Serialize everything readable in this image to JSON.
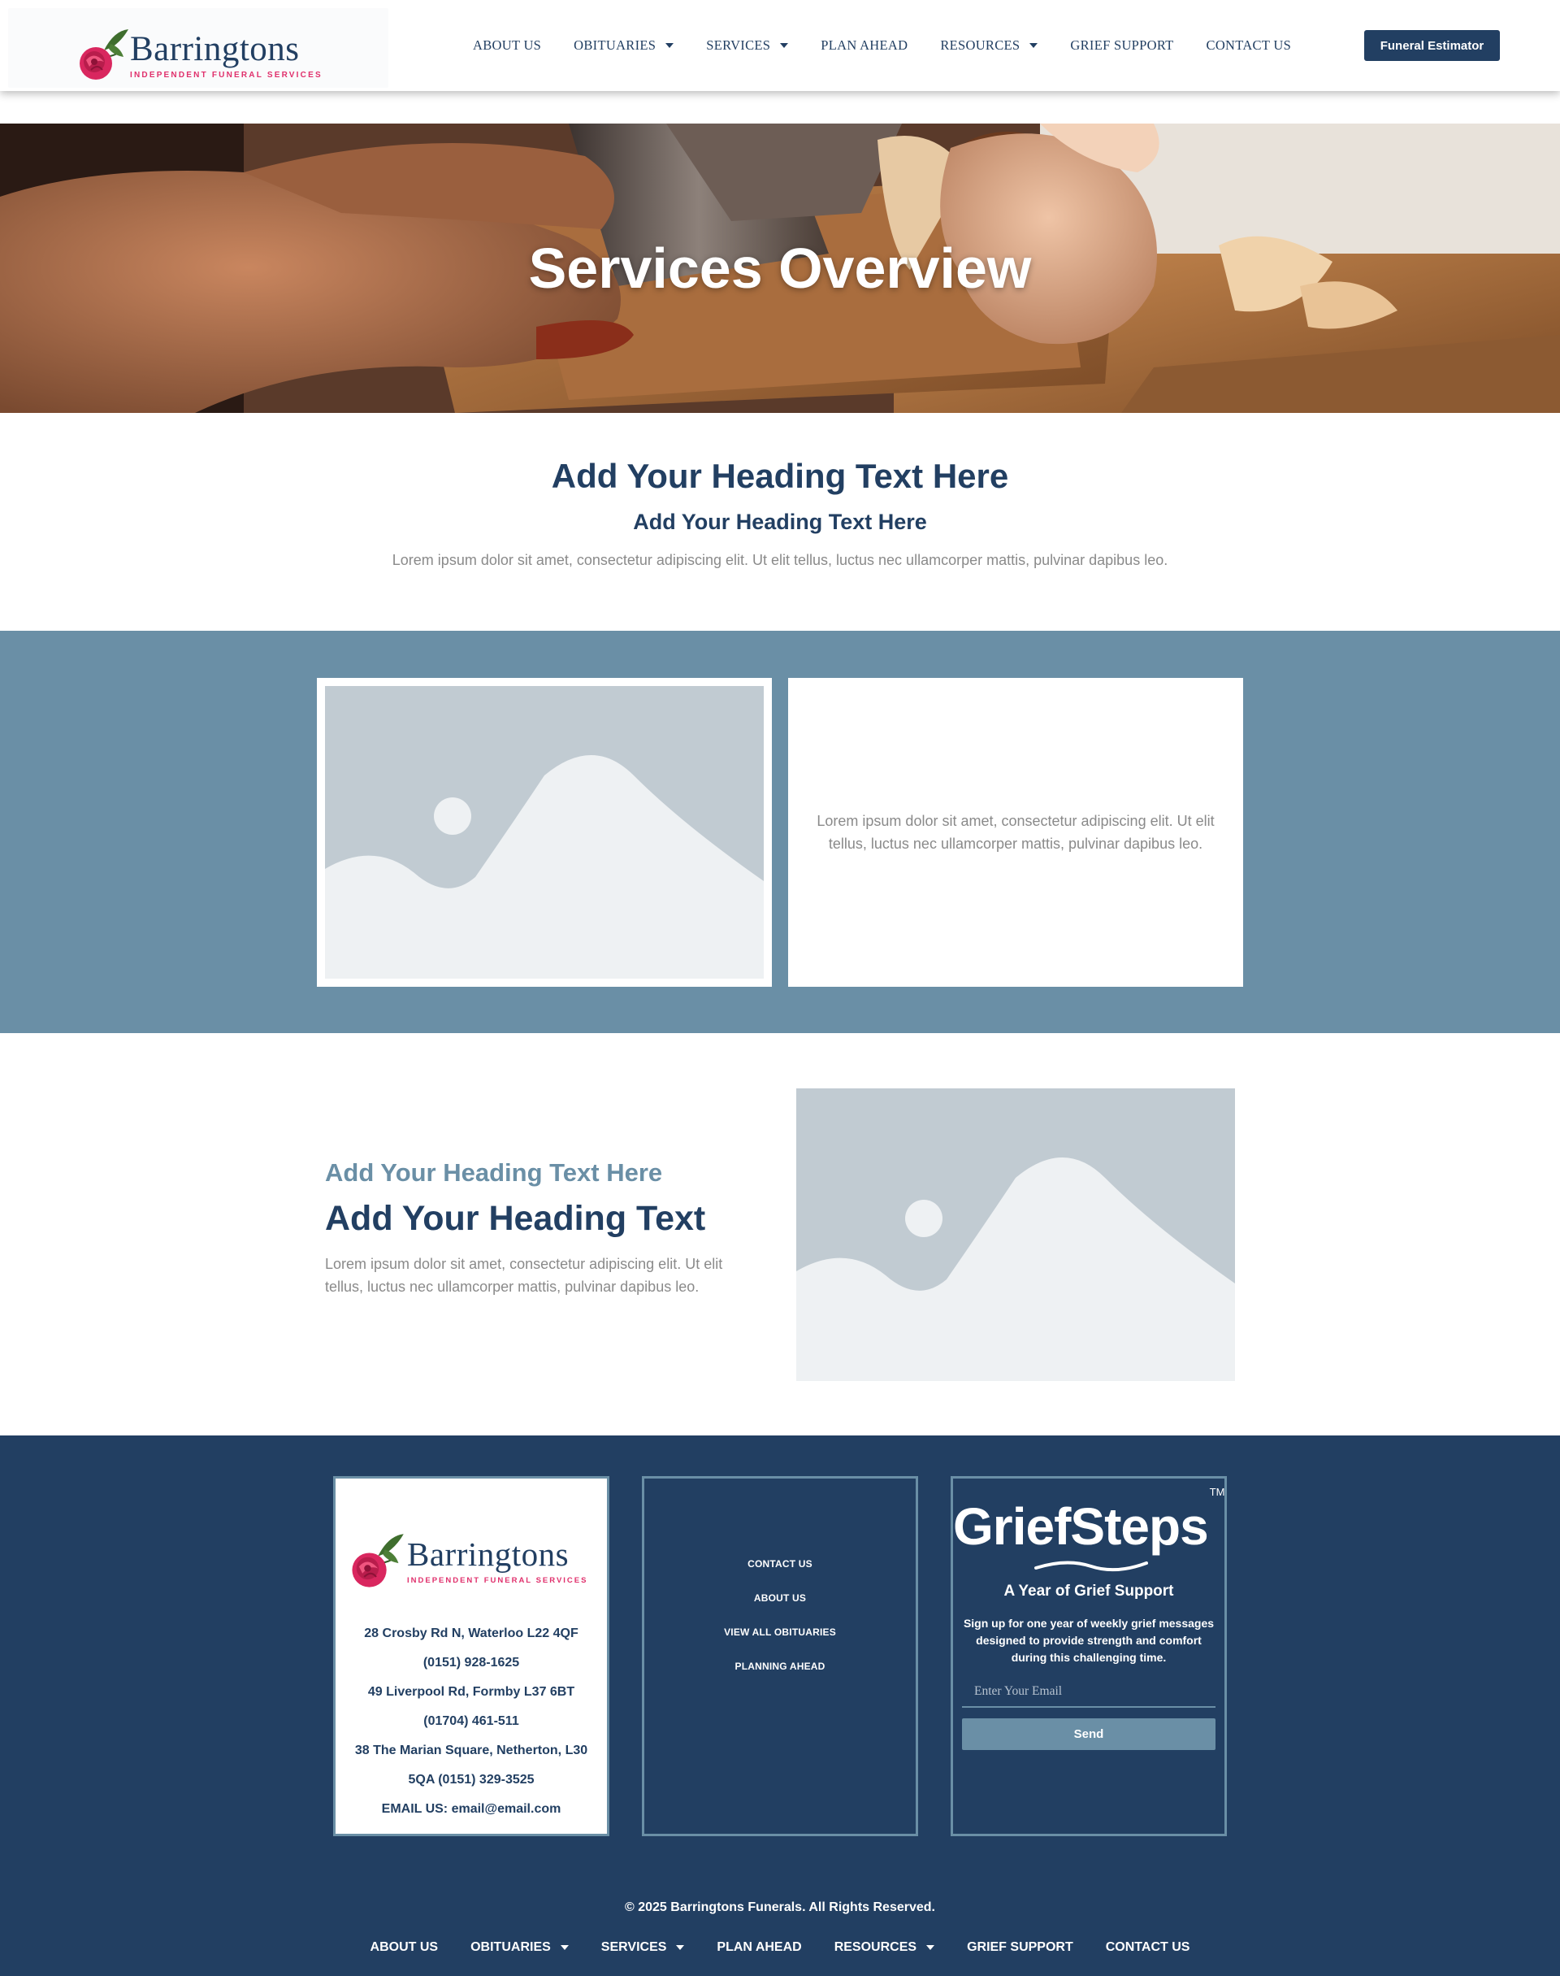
{
  "header": {
    "logo": {
      "name": "Barringtons",
      "tagline": "INDEPENDENT FUNERAL SERVICES"
    },
    "nav": [
      {
        "label": "ABOUT US",
        "dropdown": false
      },
      {
        "label": "OBITUARIES",
        "dropdown": true
      },
      {
        "label": "SERVICES",
        "dropdown": true
      },
      {
        "label": "PLAN AHEAD",
        "dropdown": false
      },
      {
        "label": "RESOURCES",
        "dropdown": true
      },
      {
        "label": "GRIEF SUPPORT",
        "dropdown": false
      },
      {
        "label": "CONTACT US",
        "dropdown": false
      }
    ],
    "cta_label": "Funeral Estimator"
  },
  "page_title": "Services Overview",
  "hero": {
    "title": "Services Overview"
  },
  "intro": {
    "heading": "Add Your Heading Text Here",
    "subheading": "Add Your Heading Text Here",
    "body": "Lorem ipsum dolor sit amet, consectetur adipiscing elit. Ut elit tellus, luctus nec ullamcorper mattis, pulvinar dapibus leo."
  },
  "band": {
    "image_icon": "image-placeholder-icon",
    "text": "Lorem ipsum dolor sit amet, consectetur adipiscing elit. Ut elit tellus, luctus nec ullamcorper mattis, pulvinar dapibus leo."
  },
  "feature": {
    "subheading": "Add Your Heading Text Here",
    "heading": "Add Your Heading Text",
    "body": "Lorem ipsum dolor sit amet, consectetur adipiscing elit. Ut elit tellus, luctus nec ullamcorper mattis, pulvinar dapibus leo."
  },
  "footer": {
    "logo": {
      "name": "Barringtons",
      "tagline": "INDEPENDENT FUNERAL SERVICES"
    },
    "contact_lines": [
      "28 Crosby Rd N, Waterloo L22 4QF",
      "(0151) 928-1625",
      "49 Liverpool Rd, Formby L37 6BT",
      "(01704) 461-511",
      "38 The Marian Square, Netherton, L30",
      "5QA (0151) 329-3525",
      "EMAIL US: email@email.com"
    ],
    "links": [
      "CONTACT US",
      "ABOUT US",
      "VIEW ALL OBITUARIES",
      "PLANNING AHEAD"
    ],
    "griefsteps": {
      "logo": "GriefSteps",
      "trademark": "TM",
      "heading": "A Year of Grief Support",
      "description": "Sign up for one year of weekly grief messages designed to provide strength and comfort during this challenging time.",
      "email_placeholder": "Enter Your Email",
      "send_label": "Send"
    },
    "copyright": "© 2025 Barringtons Funerals. All Rights Reserved.",
    "nav": [
      {
        "label": "ABOUT US",
        "dropdown": false
      },
      {
        "label": "OBITUARIES",
        "dropdown": true
      },
      {
        "label": "SERVICES",
        "dropdown": true
      },
      {
        "label": "PLAN AHEAD",
        "dropdown": false
      },
      {
        "label": "RESOURCES",
        "dropdown": true
      },
      {
        "label": "GRIEF SUPPORT",
        "dropdown": false
      },
      {
        "label": "CONTACT US",
        "dropdown": false
      }
    ]
  },
  "colors": {
    "navy": "#223f62",
    "steel_blue": "#6a8fa6",
    "accent_pink": "#e0306c",
    "body_gray": "#8a8a8a"
  }
}
